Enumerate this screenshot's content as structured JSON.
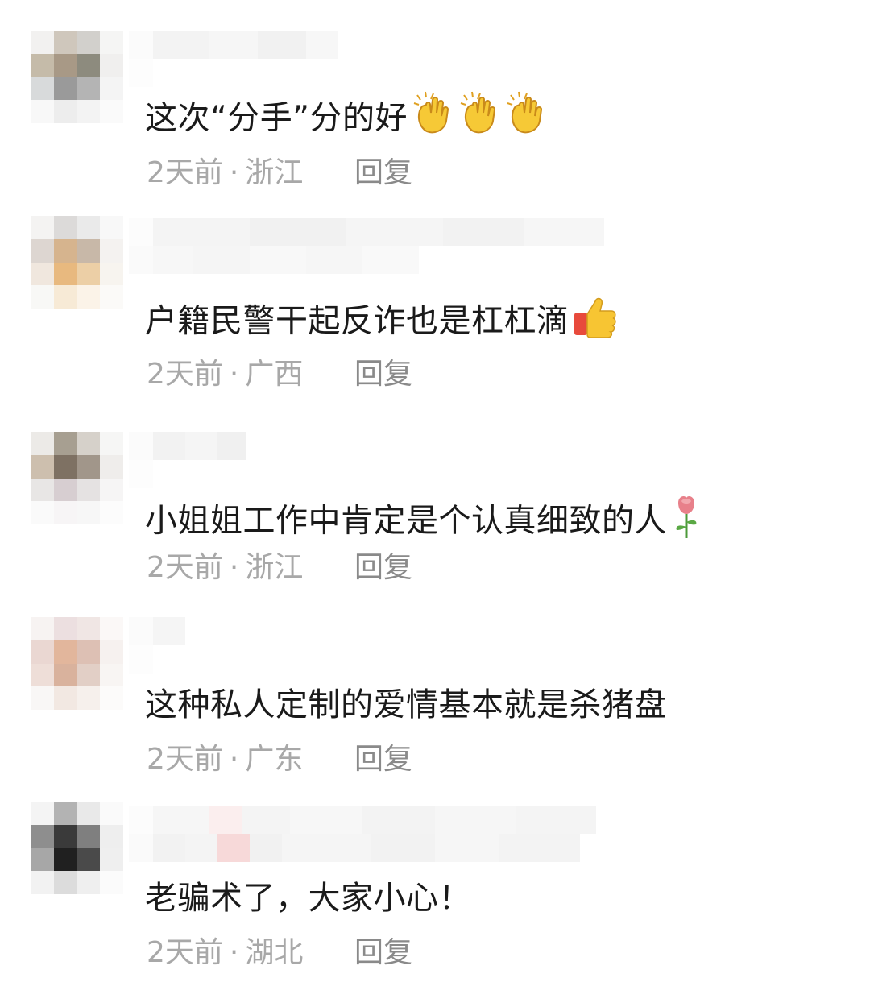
{
  "comments": [
    {
      "text": "这次“分手”分的好",
      "emoji": "clap-icon",
      "emoji_count": 3,
      "time": "2天前",
      "separator": "·",
      "location": "浙江",
      "reply": "回复",
      "avatar_colors": [
        "#f2f1f0",
        "#cfc7bc",
        "#d2d0cc",
        "#f5f5f4",
        "#c5bba9",
        "#a89986",
        "#8d8b7e",
        "#f0efee",
        "#d8dadb",
        "#9a9a9a",
        "#b4b4b4",
        "#f4f4f4",
        "#f8f8f8",
        "#ededed",
        "#f3f3f3",
        "#fafafa"
      ]
    },
    {
      "text": "户籍民警干起反诈也是杠杠滴",
      "emoji": "thumbs-up-icon",
      "emoji_count": 1,
      "time": "2天前",
      "separator": "·",
      "location": "广西",
      "reply": "回复",
      "avatar_colors": [
        "#f4f3f2",
        "#dcdad9",
        "#eaeaea",
        "#f8f8f8",
        "#ddd6d1",
        "#d6b48e",
        "#c8b8a8",
        "#f4f2f0",
        "#f0e7de",
        "#e8b97f",
        "#eccfa6",
        "#f7f4ef",
        "#f8f8f6",
        "#f7ead6",
        "#fbf3e8",
        "#fbfaf8"
      ]
    },
    {
      "text": "小姐姐工作中肯定是个认真细致的人",
      "emoji": "rose-icon",
      "emoji_count": 1,
      "time": "2天前",
      "separator": "·",
      "location": "浙江",
      "reply": "回复",
      "avatar_colors": [
        "#eceae7",
        "#a79f91",
        "#d6d1ca",
        "#f6f6f5",
        "#cdbfae",
        "#7e7163",
        "#a1968a",
        "#efedeb",
        "#e8e6e5",
        "#d7ced1",
        "#e5e2e2",
        "#f6f5f5",
        "#fafafa",
        "#f7f5f6",
        "#f7f7f7",
        "#fcfcfc"
      ]
    },
    {
      "text": "这种私人定制的爱情基本就是杀猪盘",
      "emoji": "",
      "emoji_count": 0,
      "time": "2天前",
      "separator": "·",
      "location": "广东",
      "reply": "回复",
      "avatar_colors": [
        "#f7f3f2",
        "#ecdfe0",
        "#f0e6e4",
        "#fbf8f7",
        "#ead7d2",
        "#e2b69c",
        "#ddc0b4",
        "#f6f1ef",
        "#eeded8",
        "#d9b29d",
        "#e2cfc6",
        "#f8f5f3",
        "#f9f7f6",
        "#f2e8e2",
        "#f6f0ec",
        "#fcfbfa"
      ]
    },
    {
      "text": "老骗术了，大家小心！",
      "emoji": "",
      "emoji_count": 0,
      "time": "2天前",
      "separator": "·",
      "location": "湖北",
      "reply": "回复",
      "avatar_colors": [
        "#f4f4f4",
        "#b3b3b3",
        "#e9e9e9",
        "#fafafa",
        "#8e8e8e",
        "#3a3a3a",
        "#7f7f7f",
        "#eeeeee",
        "#a7a7a7",
        "#202020",
        "#4a4a4a",
        "#efefef",
        "#f2f2f2",
        "#dcdcdc",
        "#efefef",
        "#fbfbfb"
      ]
    }
  ]
}
